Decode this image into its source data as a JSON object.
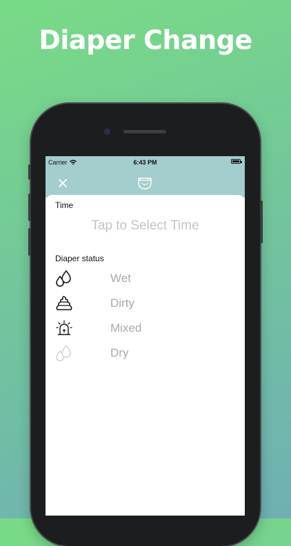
{
  "promo": {
    "title": "Diaper Change"
  },
  "status_bar": {
    "carrier": "Carrier",
    "time": "6:43 PM"
  },
  "nav": {
    "close_icon": "close-icon",
    "title_icon": "diaper-icon"
  },
  "form": {
    "time_label": "Time",
    "time_placeholder": "Tap to Select Time",
    "status_label": "Diaper status",
    "options": [
      {
        "label": "Wet",
        "icon": "droplets-icon",
        "enabled": true
      },
      {
        "label": "Dirty",
        "icon": "poop-icon",
        "enabled": true
      },
      {
        "label": "Mixed",
        "icon": "alarm-icon",
        "enabled": true
      },
      {
        "label": "Dry",
        "icon": "droplets-icon",
        "enabled": false
      }
    ]
  },
  "colors": {
    "bar": "#a4cdcd",
    "placeholder": "#c4c4c4",
    "option_text": "#a9a9a9",
    "icon_active": "#111111",
    "icon_disabled": "#d4d4d4"
  }
}
